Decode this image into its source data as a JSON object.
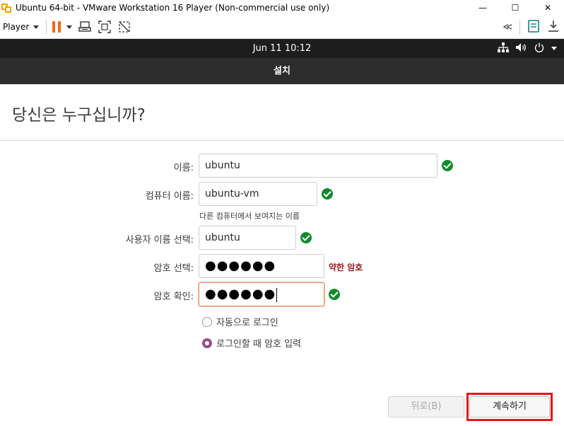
{
  "window": {
    "title": "Ubuntu 64-bit - VMware Workstation 16 Player (Non-commercial use only)",
    "minimize": "—",
    "maximize": "☐",
    "close": "✕"
  },
  "toolbar": {
    "player_menu": "Player",
    "icons": [
      "pause-icon",
      "send-ctrl-alt-del-icon",
      "fullscreen-icon",
      "unity-icon",
      "collapse-icon",
      "message-log-icon",
      "download-icon"
    ]
  },
  "topbar": {
    "clock": "Jun 11  10:12",
    "icons": [
      "network-icon",
      "volume-icon",
      "power-icon"
    ]
  },
  "installer": {
    "header": "설치",
    "title": "당신은 누구십니까?",
    "name_label": "이름:",
    "name_value": "ubuntu",
    "computer_label": "컴퓨터 이름:",
    "computer_value": "ubuntu-vm",
    "computer_hint": "다른 컴퓨터에서 보여지는 이름",
    "username_label": "사용자 이름 선택:",
    "username_value": "ubuntu",
    "password_label": "암호 선택:",
    "password_value": "●●●●●●",
    "password_strength": "약한 암호",
    "confirm_label": "암호 확인:",
    "confirm_value": "●●●●●●",
    "autologin_option": "자동으로 로그인",
    "require_password_option": "로그인할 때 암호 입력",
    "selected_option": "require_password",
    "back_button": "뒤로(B)",
    "continue_button": "계속하기"
  },
  "colors": {
    "accent": "#924d8b",
    "valid": "#118a2f",
    "weak": "#9a1a1a",
    "highlight": "#e3151b"
  }
}
